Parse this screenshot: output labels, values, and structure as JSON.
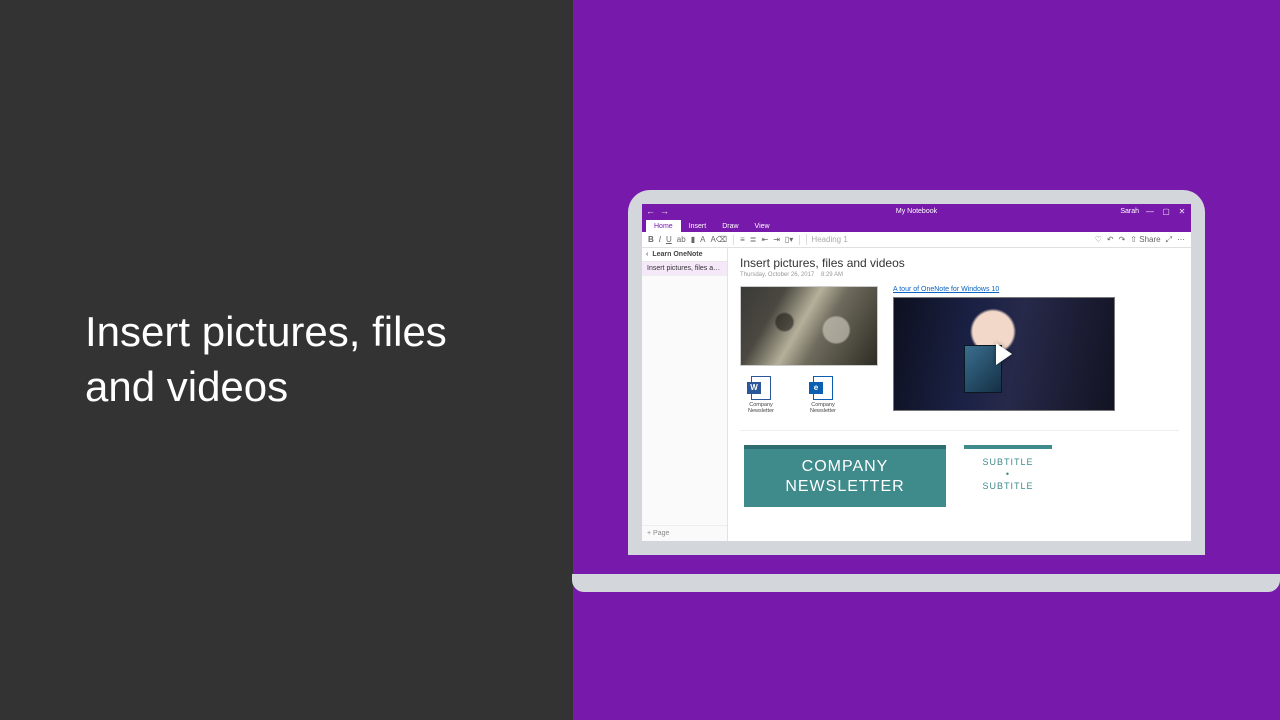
{
  "slide": {
    "title": "Insert pictures, files and videos"
  },
  "titlebar": {
    "notebook": "My Notebook",
    "user": "Sarah"
  },
  "ribbon": {
    "tabs": [
      "Home",
      "Insert",
      "Draw",
      "View"
    ],
    "heading_placeholder": "Heading 1",
    "share": "Share"
  },
  "sidebar": {
    "section": "Learn OneNote",
    "page": "Insert pictures, files an…",
    "add_page": "+  Page"
  },
  "page": {
    "title": "Insert pictures, files and videos",
    "date": "Thursday, October 26, 2017",
    "time": "8:29 AM",
    "video_link": "A tour of OneNote for Windows 10",
    "files": [
      {
        "label": "Company Newsletter"
      },
      {
        "label": "Company Newsletter"
      }
    ],
    "newsletter": {
      "line1": "COMPANY",
      "line2": "NEWSLETTER",
      "sub1": "SUBTITLE",
      "sub2": "SUBTITLE"
    }
  }
}
